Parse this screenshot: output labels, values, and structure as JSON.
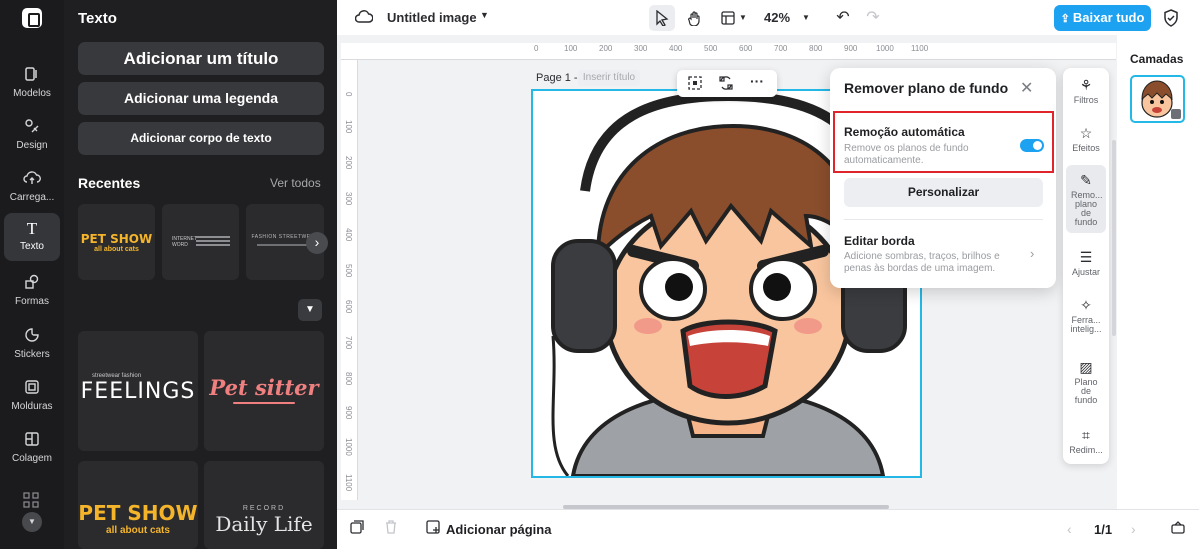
{
  "nav": {
    "items": [
      {
        "label": "Modelos",
        "icon": "template-icon"
      },
      {
        "label": "Design",
        "icon": "design-icon"
      },
      {
        "label": "Carrega...",
        "icon": "upload-cloud-icon"
      },
      {
        "label": "Texto",
        "icon": "text-icon"
      },
      {
        "label": "Formas",
        "icon": "shapes-icon"
      },
      {
        "label": "Stickers",
        "icon": "sticker-icon"
      },
      {
        "label": "Molduras",
        "icon": "frame-icon"
      },
      {
        "label": "Colagem",
        "icon": "collage-icon"
      }
    ],
    "active": "Texto"
  },
  "panel": {
    "title": "Texto",
    "add_title": "Adicionar um título",
    "add_caption": "Adicionar uma legenda",
    "add_body": "Adicionar corpo de texto",
    "recents_label": "Recentes",
    "see_all": "Ver todos",
    "recent_templates": [
      {
        "line1": "PET SHOW",
        "line2": "all about cats"
      },
      {
        "line1": "INTERNET",
        "line2": "WORD"
      },
      {
        "line1": "FASHION STREETWEAR",
        "line2": ""
      }
    ],
    "gallery": [
      {
        "line1": "streetwear fashion",
        "line2": "FEELINGS"
      },
      {
        "line1": "Pet sitter",
        "line2": ""
      },
      {
        "line1": "PET SHOW",
        "line2": "all about cats"
      },
      {
        "line1": "RECORD",
        "line2": "Daily Life"
      }
    ]
  },
  "topbar": {
    "file_name": "Untitled image",
    "zoom": "42%",
    "upload_label": "Baixar tudo"
  },
  "ruler": {
    "h_ticks": [
      "0",
      "100",
      "200",
      "300",
      "400",
      "500",
      "600",
      "700",
      "800",
      "900",
      "1000",
      "1100"
    ],
    "v_ticks": [
      "0",
      "100",
      "200",
      "300",
      "400",
      "500",
      "600",
      "700",
      "800",
      "900",
      "1000",
      "1100"
    ]
  },
  "page": {
    "label": "Page 1 -",
    "title_placeholder": "Inserir título"
  },
  "bg_popup": {
    "title": "Remover plano de fundo",
    "auto_title": "Remoção automática",
    "auto_desc": "Remove os planos de fundo automaticamente.",
    "toggle_on": true,
    "customize_label": "Personalizar",
    "border_title": "Editar borda",
    "border_desc": "Adicione sombras, traços, brilhos e penas às bordas de uma imagem."
  },
  "right_tools": [
    {
      "label": "Filtros",
      "icon": "filter-icon"
    },
    {
      "label": "Efeitos",
      "icon": "effects-icon"
    },
    {
      "label": "Remo... plano de fundo",
      "icon": "remove-bg-icon",
      "active": true
    },
    {
      "label": "Ajustar",
      "icon": "sliders-icon"
    },
    {
      "label": "Ferra... intelig...",
      "icon": "magic-wand-icon"
    },
    {
      "label": "Plano de fundo",
      "icon": "background-icon"
    },
    {
      "label": "Redim...",
      "icon": "resize-icon"
    }
  ],
  "layers": {
    "title": "Camadas"
  },
  "bottom": {
    "add_page": "Adicionar página",
    "page_count": "1/1"
  },
  "colors": {
    "accent": "#1ca2f1",
    "selection": "#23b8e6",
    "highlight_box": "#e0242b"
  }
}
